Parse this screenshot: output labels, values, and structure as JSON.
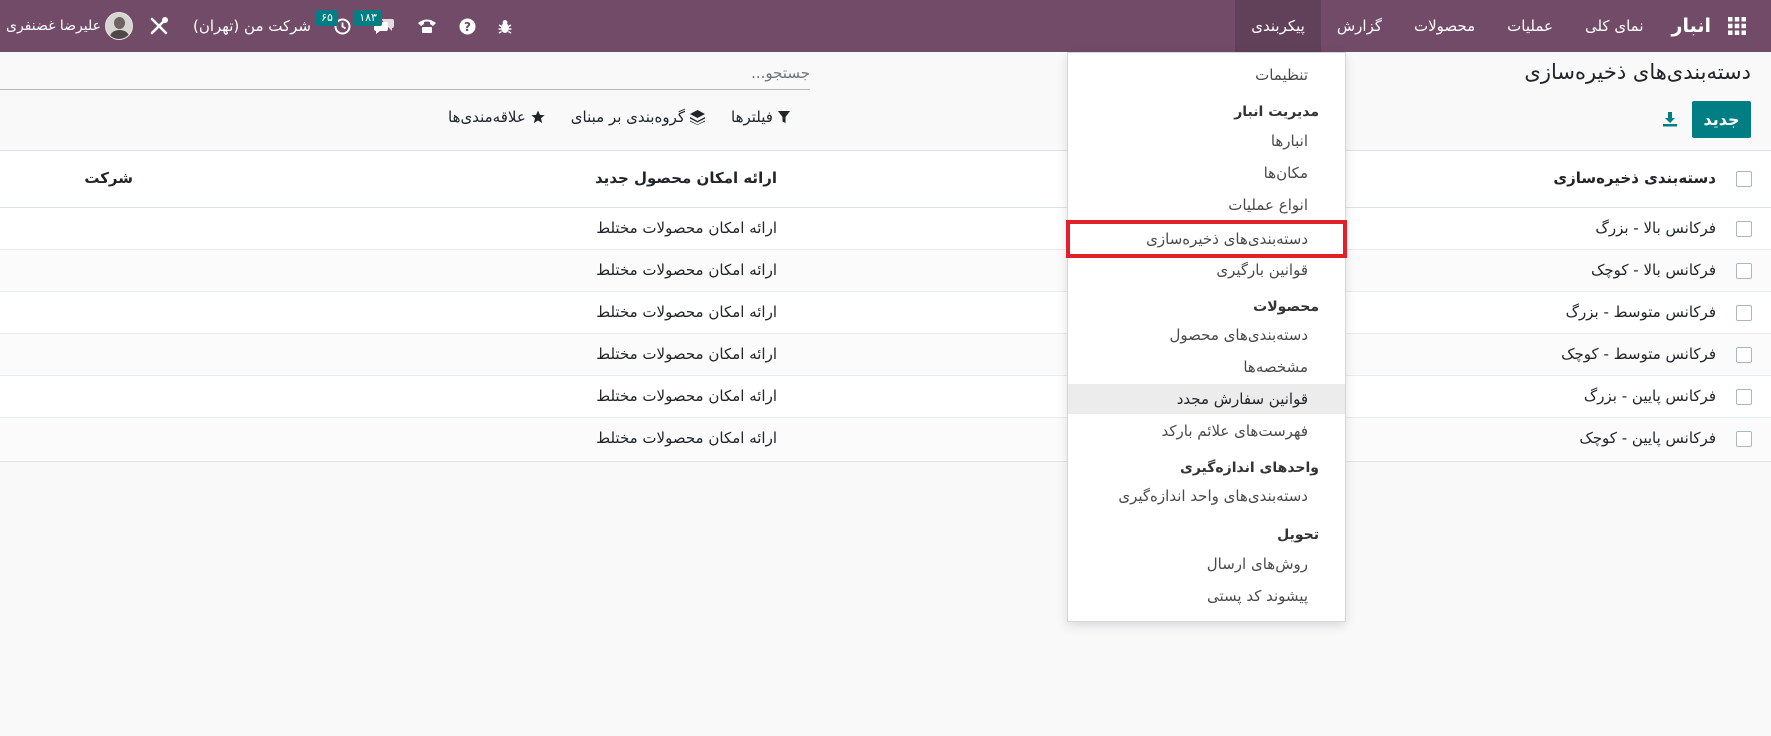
{
  "navbar": {
    "brand": "انبار",
    "menu": [
      "نمای کلی",
      "عملیات",
      "محصولات",
      "گزارش",
      "پیکربندی"
    ],
    "active_menu": "پیکربندی",
    "chat_count": "۱۸۳",
    "activity_count": "۶۵",
    "company": "شرکت من (تهران)",
    "user": "علیرضا غضنفری",
    "color": "#714b67"
  },
  "control": {
    "title": "دسته‌بندی‌های ذخیره‌سازی",
    "new_label": "جدید",
    "search_placeholder": "جستجو...",
    "filters_label": "فیلترها",
    "groupby_label": "گروه‌بندی بر مبنای",
    "favorites_label": "علاقه‌مندی‌ها",
    "accent": "#017e84"
  },
  "table": {
    "columns": [
      "دسته‌بندی ذخیره‌سازی",
      "ارائه امکان محصول جدید",
      "شرکت"
    ],
    "rows": [
      {
        "name": "فرکانس بالا - بزرگ",
        "allow": "ارائه امکان محصولات مختلط"
      },
      {
        "name": "فرکانس بالا - کوچک",
        "allow": "ارائه امکان محصولات مختلط"
      },
      {
        "name": "فرکانس متوسط - بزرگ",
        "allow": "ارائه امکان محصولات مختلط"
      },
      {
        "name": "فرکانس متوسط - کوچک",
        "allow": "ارائه امکان محصولات مختلط"
      },
      {
        "name": "فرکانس پایین - بزرگ",
        "allow": "ارائه امکان محصولات مختلط"
      },
      {
        "name": "فرکانس پایین - کوچک",
        "allow": "ارائه امکان محصولات مختلط"
      }
    ]
  },
  "dropdown": {
    "settings": "تنظیمات",
    "warehouse_header": "مدیریت انبار",
    "warehouses": "انبارها",
    "locations": "مکان‌ها",
    "operation_types": "انواع عملیات",
    "storage_categories": "دسته‌بندی‌های ذخیره‌سازی",
    "putaway_rules": "قوانین بارگیری",
    "products_header": "محصولات",
    "product_categories": "دسته‌بندی‌های محصول",
    "attributes": "مشخصه‌ها",
    "reordering_rules": "قوانین سفارش مجدد",
    "barcode_nomenclatures": "فهرست‌های علائم بارکد",
    "uom_header": "واحدهای اندازه‌گیری",
    "uom_categories": "دسته‌بندی‌های واحد اندازه‌گیری",
    "delivery_header": "تحویل",
    "shipping_methods": "روش‌های ارسال",
    "zip_prefix": "پیشوند کد پستی",
    "highlight_color": "#e0202d"
  }
}
